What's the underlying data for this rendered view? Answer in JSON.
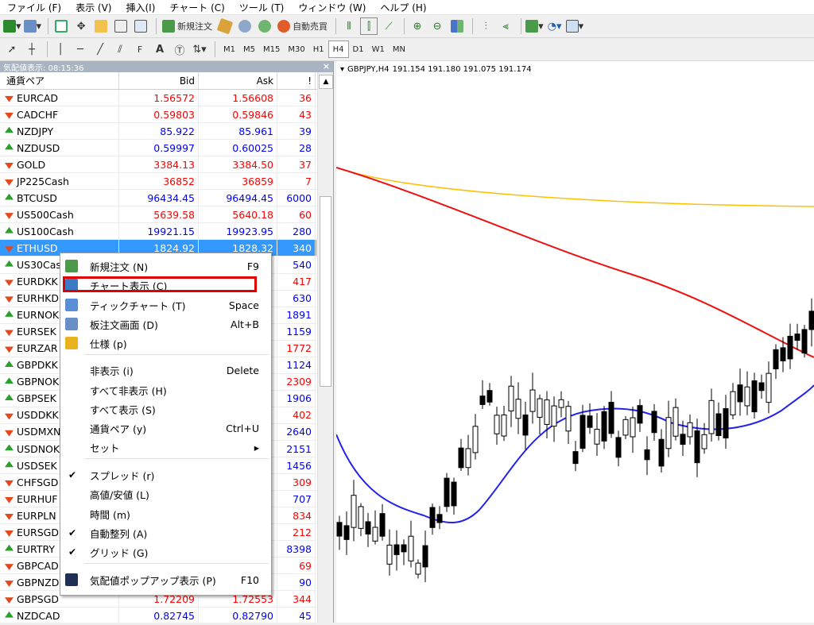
{
  "menu": [
    "ファイル (F)",
    "表示 (V)",
    "挿入(I)",
    "チャート (C)",
    "ツール (T)",
    "ウィンドウ (W)",
    "ヘルプ (H)"
  ],
  "toolbar1": {
    "new_order": "新規注文",
    "auto_trading": "自動売買"
  },
  "toolbar2": {
    "timeframes": [
      "M1",
      "M5",
      "M15",
      "M30",
      "H1",
      "H4",
      "D1",
      "W1",
      "MN"
    ],
    "active_timeframe": "H4"
  },
  "market_watch": {
    "title": "気配値表示: 08:15:36",
    "columns": {
      "symbol": "通貨ペア",
      "bid": "Bid",
      "ask": "Ask",
      "spread": "!"
    },
    "rows": [
      {
        "symbol": "EURCAD",
        "bid": "1.56572",
        "ask": "1.56608",
        "spread": "36",
        "dir": "down",
        "color": "red"
      },
      {
        "symbol": "CADCHF",
        "bid": "0.59803",
        "ask": "0.59846",
        "spread": "43",
        "dir": "down",
        "color": "red"
      },
      {
        "symbol": "NZDJPY",
        "bid": "85.922",
        "ask": "85.961",
        "spread": "39",
        "dir": "up",
        "color": "blue"
      },
      {
        "symbol": "NZDUSD",
        "bid": "0.59997",
        "ask": "0.60025",
        "spread": "28",
        "dir": "up",
        "color": "blue"
      },
      {
        "symbol": "GOLD",
        "bid": "3384.13",
        "ask": "3384.50",
        "spread": "37",
        "dir": "down",
        "color": "red"
      },
      {
        "symbol": "JP225Cash",
        "bid": "36852",
        "ask": "36859",
        "spread": "7",
        "dir": "down",
        "color": "red"
      },
      {
        "symbol": "BTCUSD",
        "bid": "96434.45",
        "ask": "96494.45",
        "spread": "6000",
        "dir": "up",
        "color": "blue"
      },
      {
        "symbol": "US500Cash",
        "bid": "5639.58",
        "ask": "5640.18",
        "spread": "60",
        "dir": "down",
        "color": "red"
      },
      {
        "symbol": "US100Cash",
        "bid": "19921.15",
        "ask": "19923.95",
        "spread": "280",
        "dir": "up",
        "color": "blue"
      },
      {
        "symbol": "ETHUSD",
        "bid": "1824.92",
        "ask": "1828.32",
        "spread": "340",
        "dir": "down",
        "color": "red",
        "selected": true
      },
      {
        "symbol": "US30Cash",
        "bid": "",
        "ask": "",
        "spread": "540",
        "dir": "up",
        "color": "blue"
      },
      {
        "symbol": "EURDKK",
        "bid": "",
        "ask": "",
        "spread": "417",
        "dir": "down",
        "color": "red"
      },
      {
        "symbol": "EURHKD",
        "bid": "",
        "ask": "",
        "spread": "630",
        "dir": "down",
        "color": "blue"
      },
      {
        "symbol": "EURNOK",
        "bid": "",
        "ask": "",
        "spread": "1891",
        "dir": "up",
        "color": "blue"
      },
      {
        "symbol": "EURSEK",
        "bid": "",
        "ask": "",
        "spread": "1159",
        "dir": "down",
        "color": "blue"
      },
      {
        "symbol": "EURZAR",
        "bid": "",
        "ask": "",
        "spread": "1772",
        "dir": "down",
        "color": "red"
      },
      {
        "symbol": "GBPDKK",
        "bid": "",
        "ask": "",
        "spread": "1124",
        "dir": "up",
        "color": "blue"
      },
      {
        "symbol": "GBPNOK",
        "bid": "",
        "ask": "",
        "spread": "2309",
        "dir": "up",
        "color": "red"
      },
      {
        "symbol": "GBPSEK",
        "bid": "",
        "ask": "",
        "spread": "1906",
        "dir": "up",
        "color": "blue"
      },
      {
        "symbol": "USDDKK",
        "bid": "",
        "ask": "",
        "spread": "402",
        "dir": "down",
        "color": "red"
      },
      {
        "symbol": "USDMXN",
        "bid": "",
        "ask": "",
        "spread": "2640",
        "dir": "down",
        "color": "blue"
      },
      {
        "symbol": "USDNOK",
        "bid": "",
        "ask": "",
        "spread": "2151",
        "dir": "up",
        "color": "blue"
      },
      {
        "symbol": "USDSEK",
        "bid": "",
        "ask": "",
        "spread": "1456",
        "dir": "up",
        "color": "blue"
      },
      {
        "symbol": "CHFSGD",
        "bid": "",
        "ask": "",
        "spread": "309",
        "dir": "down",
        "color": "red"
      },
      {
        "symbol": "EURHUF",
        "bid": "",
        "ask": "",
        "spread": "707",
        "dir": "down",
        "color": "blue"
      },
      {
        "symbol": "EURPLN",
        "bid": "",
        "ask": "",
        "spread": "834",
        "dir": "down",
        "color": "red"
      },
      {
        "symbol": "EURSGD",
        "bid": "",
        "ask": "",
        "spread": "212",
        "dir": "down",
        "color": "red"
      },
      {
        "symbol": "EURTRY",
        "bid": "",
        "ask": "",
        "spread": "8398",
        "dir": "up",
        "color": "blue"
      },
      {
        "symbol": "GBPCAD",
        "bid": "",
        "ask": "",
        "spread": "69",
        "dir": "down",
        "color": "red"
      },
      {
        "symbol": "GBPNZD",
        "bid": "",
        "ask": "",
        "spread": "90",
        "dir": "down",
        "color": "blue"
      },
      {
        "symbol": "GBPSGD",
        "bid": "1.72209",
        "ask": "1.72553",
        "spread": "344",
        "dir": "down",
        "color": "red"
      },
      {
        "symbol": "NZDCAD",
        "bid": "0.82745",
        "ask": "0.82790",
        "spread": "45",
        "dir": "up",
        "color": "blue"
      }
    ]
  },
  "context_menu": [
    {
      "label": "新規注文 (N)",
      "shortcut": "F9",
      "icon": "new-order-icon"
    },
    {
      "label": "チャート表示 (C)",
      "shortcut": "",
      "icon": "chart-window-icon",
      "highlighted": true
    },
    {
      "label": "ティックチャート (T)",
      "shortcut": "Space",
      "icon": "tick-chart-icon"
    },
    {
      "label": "板注文画面 (D)",
      "shortcut": "Alt+B",
      "icon": "depth-of-market-icon"
    },
    {
      "label": "仕様 (p)",
      "shortcut": "",
      "icon": "specification-icon"
    },
    {
      "label": "非表示 (i)",
      "shortcut": "Delete"
    },
    {
      "label": "すべて非表示 (H)",
      "shortcut": ""
    },
    {
      "label": "すべて表示 (S)",
      "shortcut": ""
    },
    {
      "label": "通貨ペア (y)",
      "shortcut": "Ctrl+U"
    },
    {
      "label": "セット",
      "shortcut": "▸",
      "submenu": true
    },
    {
      "label": "スプレッド (r)",
      "shortcut": "",
      "checked": true
    },
    {
      "label": "高値/安値 (L)",
      "shortcut": ""
    },
    {
      "label": "時間 (m)",
      "shortcut": ""
    },
    {
      "label": "自動整列 (A)",
      "shortcut": "",
      "checked": true
    },
    {
      "label": "グリッド (G)",
      "shortcut": "",
      "checked": true
    },
    {
      "label": "気配値ポップアップ表示 (P)",
      "shortcut": "F10",
      "icon": "popup-prices-icon"
    }
  ],
  "chart": {
    "symbol_line": "GBPJPY,H4",
    "ohlc": "191.154 191.180 191.075 191.174",
    "colors": {
      "ma_yellow": "#ffc000",
      "ma_red": "#ee1111",
      "ma_blue": "#2222ee",
      "candles": "#000000"
    }
  }
}
